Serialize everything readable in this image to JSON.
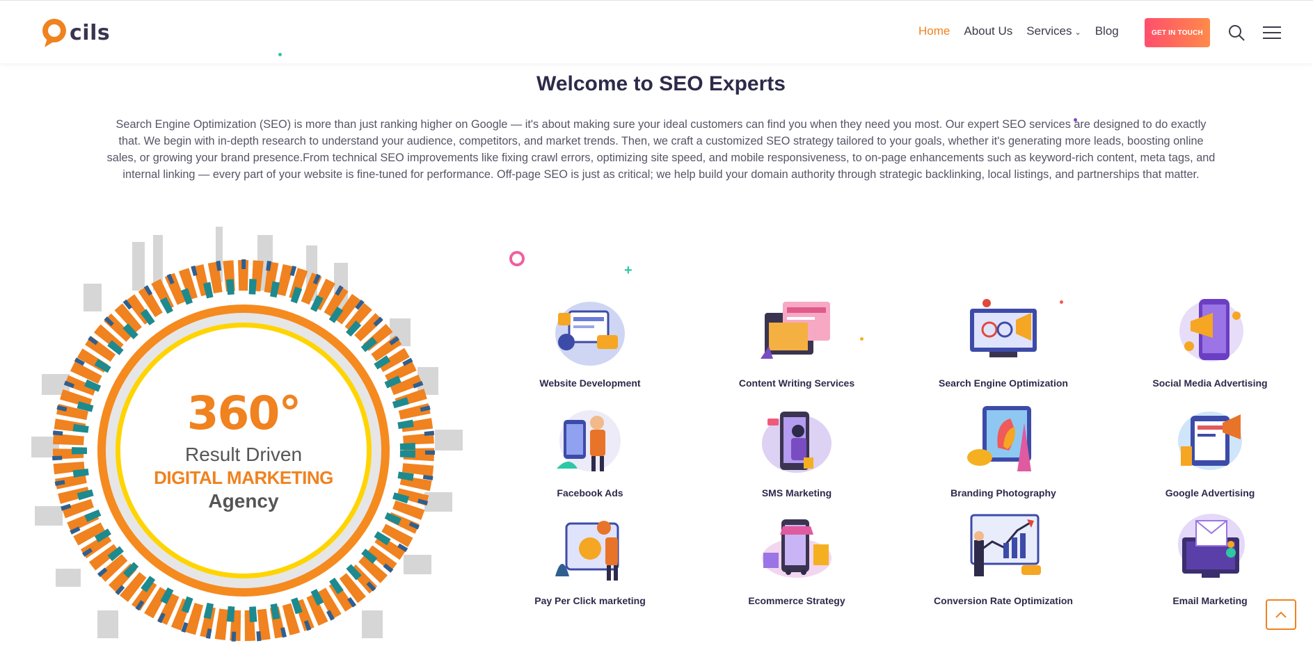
{
  "header": {
    "logo_text": "cils",
    "nav": [
      {
        "label": "Home",
        "active": true
      },
      {
        "label": "About Us",
        "active": false
      },
      {
        "label": "Services",
        "active": false
      },
      {
        "label": "Blog",
        "active": false
      }
    ],
    "cta_label": "GET IN TOUCH",
    "search_icon": "search-icon",
    "menu_icon": "hamburger-menu-icon"
  },
  "main": {
    "title": "Welcome to SEO Experts",
    "intro": "Search Engine Optimization (SEO) is more than just ranking higher on Google — it's about making sure your ideal customers can find you when they need you most. Our expert SEO services are designed to do exactly that. We begin with in-depth research to understand your audience, competitors, and market trends. Then, we craft a customized SEO strategy tailored to your goals, whether it's generating more leads, boosting online sales, or growing your brand presence.From technical SEO improvements like fixing crawl errors, optimizing site speed, and mobile responsiveness, to on-page enhancements such as keyword-rich content, meta tags, and internal linking — every part of your website is fine-tuned for performance. Off-page SEO is just as critical; we help build your domain authority through strategic backlinking, local listings, and partnerships that matter."
  },
  "hero": {
    "number": "360°",
    "line1": "Result Driven",
    "line2": "DIGITAL MARKETING",
    "line3": "Agency"
  },
  "services": [
    {
      "label": "Website Development",
      "icon": "website-development-illustration"
    },
    {
      "label": "Content Writing Services",
      "icon": "content-writing-illustration"
    },
    {
      "label": "Search Engine Optimization",
      "icon": "seo-illustration"
    },
    {
      "label": "Social Media Advertising",
      "icon": "social-media-illustration"
    },
    {
      "label": "Facebook Ads",
      "icon": "facebook-ads-illustration"
    },
    {
      "label": "SMS Marketing",
      "icon": "sms-marketing-illustration"
    },
    {
      "label": "Branding Photography",
      "icon": "branding-photography-illustration"
    },
    {
      "label": "Google Advertising",
      "icon": "google-advertising-illustration"
    },
    {
      "label": "Pay Per Click marketing",
      "icon": "ppc-illustration"
    },
    {
      "label": "Ecommerce Strategy",
      "icon": "ecommerce-illustration"
    },
    {
      "label": "Conversion Rate Optimization",
      "icon": "cro-illustration"
    },
    {
      "label": "Email Marketing",
      "icon": "email-marketing-illustration"
    }
  ],
  "colors": {
    "accent": "#f0821f",
    "heading": "#2d2a4a",
    "cta_start": "#ff4f6c",
    "cta_end": "#ff8a4a"
  },
  "scroll_top_icon": "chevron-up-icon"
}
